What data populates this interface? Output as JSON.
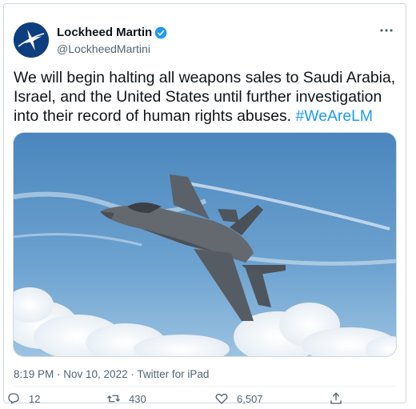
{
  "author": {
    "display_name": "Lockheed Martin",
    "handle": "@LockheedMartini",
    "verified": true
  },
  "tweet": {
    "text": "We will begin halting all weapons sales to Saudi Arabia, Israel, and the United States until further investigation into their record of human rights abuses.",
    "hashtag": "#WeAreLM"
  },
  "meta": {
    "timestamp": "8:19 PM · Nov 10, 2022 · Twitter for iPad"
  },
  "actions": {
    "replies": "12",
    "retweets": "430",
    "likes": "6,507"
  },
  "colors": {
    "accent": "#1d9bf0",
    "text": "#0f1419",
    "secondary": "#536471",
    "avatar_bg": "#0d3f7f"
  },
  "icons": {
    "verified": "verified-badge-icon",
    "more": "more-horizontal-icon",
    "reply": "reply-icon",
    "retweet": "retweet-icon",
    "like": "heart-icon",
    "share": "share-icon"
  }
}
